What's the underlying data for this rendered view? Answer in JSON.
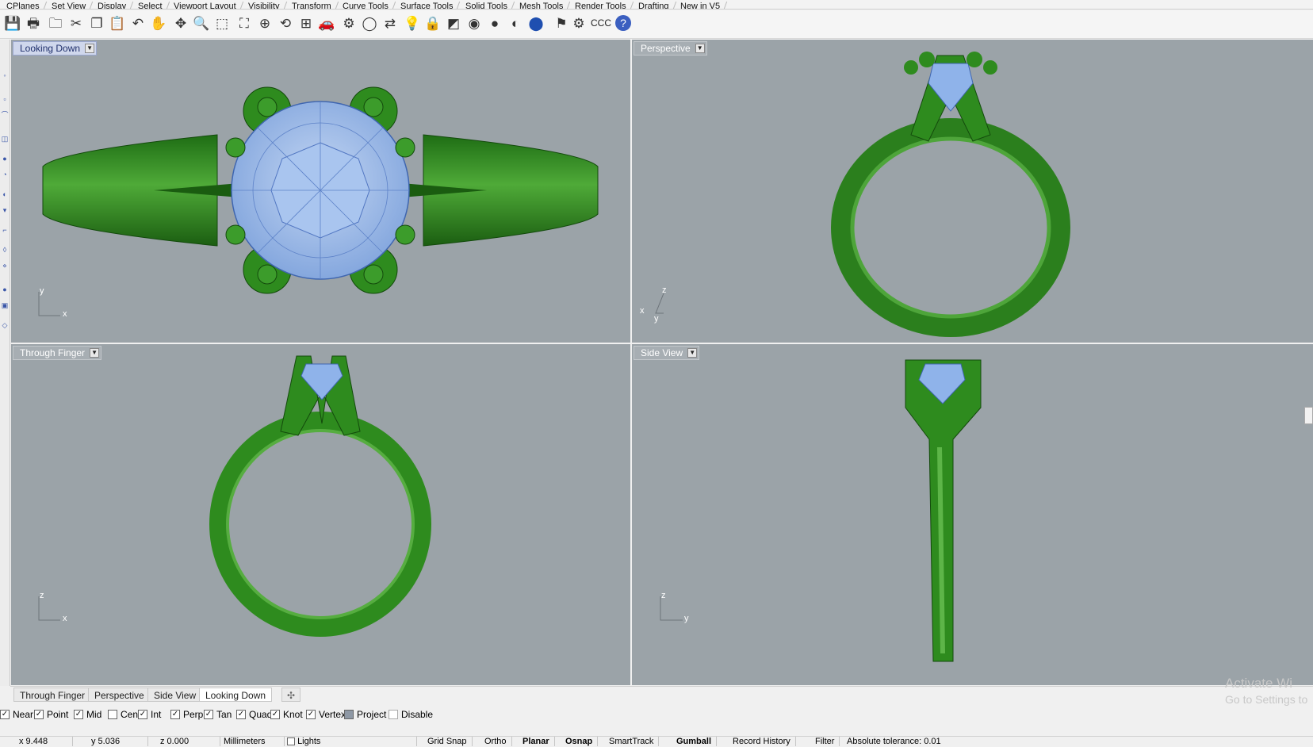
{
  "menu_tabs": [
    "CPlanes",
    "Set View",
    "Display",
    "Select",
    "Viewport Layout",
    "Visibility",
    "Transform",
    "Curve Tools",
    "Surface Tools",
    "Solid Tools",
    "Mesh Tools",
    "Render Tools",
    "Drafting",
    "New in V5"
  ],
  "toolbar": {
    "icons": [
      "save-icon",
      "print-icon",
      "open-icon",
      "cut-icon",
      "copy-icon",
      "paste-icon",
      "undo-icon",
      "pan-hand-icon",
      "rotate-view-icon",
      "zoom-icon",
      "zoom-window-icon",
      "zoom-extents-icon",
      "zoom-selected-icon",
      "undo-view-icon",
      "four-viewports-icon",
      "car-icon",
      "ghosted-icon",
      "circle-snap-icon",
      "gumball-icon",
      "light-bulb-icon",
      "lock-icon",
      "shaded-icon",
      "color-wheel-icon",
      "material-sphere-icon",
      "render-sphere-icon",
      "blue-sphere-icon",
      "flag-icon",
      "gear-icon",
      "help-icon"
    ],
    "ccc_label": "CCC"
  },
  "viewports": [
    {
      "title": "Looking Down",
      "active": true,
      "axes": [
        "y",
        "x"
      ]
    },
    {
      "title": "Perspective",
      "active": false,
      "axes": [
        "z",
        "x",
        "y"
      ]
    },
    {
      "title": "Through Finger",
      "active": false,
      "axes": [
        "z",
        "x"
      ]
    },
    {
      "title": "Side View",
      "active": false,
      "axes": [
        "z",
        "y"
      ]
    }
  ],
  "viewport_tabs": [
    "Through Finger",
    "Perspective",
    "Side View",
    "Looking Down"
  ],
  "viewport_tab_plus": "✣",
  "osnaps": [
    {
      "label": "Near",
      "checked": true
    },
    {
      "label": "Point",
      "checked": true
    },
    {
      "label": "Mid",
      "checked": true
    },
    {
      "label": "Cen",
      "checked": false
    },
    {
      "label": "Int",
      "checked": true
    },
    {
      "label": "Perp",
      "checked": true
    },
    {
      "label": "Tan",
      "checked": true
    },
    {
      "label": "Quad",
      "checked": true
    },
    {
      "label": "Knot",
      "checked": true
    },
    {
      "label": "Vertex",
      "checked": true
    },
    {
      "label": "Project",
      "checked": false
    },
    {
      "label": "Disable",
      "checked": false
    }
  ],
  "status": {
    "x": "x 9.448",
    "y": "y 5.036",
    "z": "z 0.000",
    "units": "Millimeters",
    "lights": "Lights",
    "grid_snap": "Grid Snap",
    "ortho": "Ortho",
    "planar": "Planar",
    "osnap": "Osnap",
    "smarttrack": "SmartTrack",
    "gumball": "Gumball",
    "record_history": "Record History",
    "filter": "Filter",
    "tolerance": "Absolute tolerance: 0.01"
  },
  "watermark": {
    "line1": "Activate Wi",
    "line2": "Go to Settings to"
  },
  "colors": {
    "viewport_bg": "#9ba3a8",
    "ring_green": "#2e8b1e",
    "gem_blue": "#8fb3ea",
    "active_tab": "#cfd7ec"
  }
}
